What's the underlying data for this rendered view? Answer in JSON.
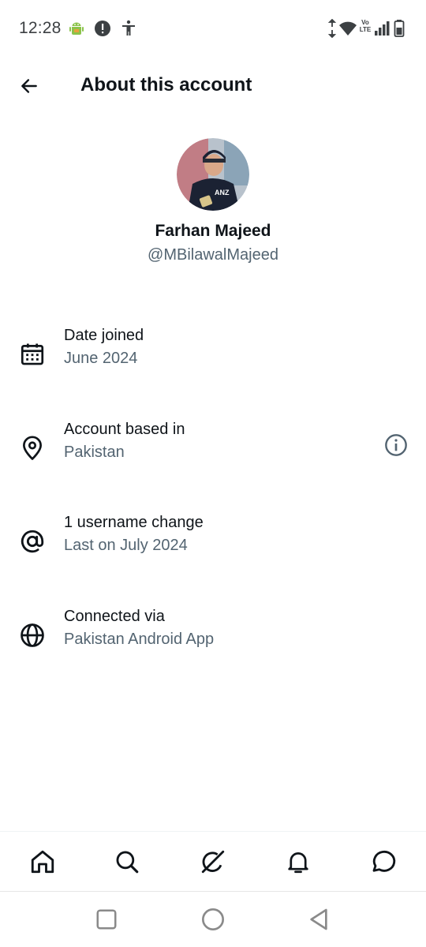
{
  "status_bar": {
    "time": "12:28",
    "left_icons": [
      "android-icon",
      "alert-icon",
      "accessibility-icon"
    ],
    "right_icons": [
      "data-arrows-icon",
      "wifi-icon",
      "volte-icon",
      "signal-icon",
      "battery-icon"
    ],
    "volte_text_top": "Vo",
    "volte_text_bottom": "LTE"
  },
  "header": {
    "back_icon": "arrow-left-icon",
    "title": "About this account"
  },
  "profile": {
    "name": "Farhan Majeed",
    "handle": "@MBilawalMajeed",
    "avatar_icon": "avatar-photo"
  },
  "info_rows": [
    {
      "icon": "calendar-icon",
      "label": "Date joined",
      "value": "June 2024"
    },
    {
      "icon": "location-pin-icon",
      "label": "Account based in",
      "value": "Pakistan",
      "trailing_icon": "info-icon"
    },
    {
      "icon": "at-sign-icon",
      "label": "1 username change",
      "value": "Last on July 2024"
    },
    {
      "icon": "globe-icon",
      "label": "Connected via",
      "value": "Pakistan Android App"
    }
  ],
  "bottom_nav": [
    "home-icon",
    "search-icon",
    "grok-icon",
    "bell-icon",
    "message-icon"
  ],
  "system_nav": [
    "recents-icon",
    "home-circle-icon",
    "back-triangle-icon"
  ],
  "colors": {
    "primary_text": "#0f1419",
    "secondary_text": "#536471",
    "status_text": "#3c4043",
    "android_green": "#8bc34a",
    "avatar_jersey": "#1b2233",
    "avatar_bg": "#c9454a"
  }
}
